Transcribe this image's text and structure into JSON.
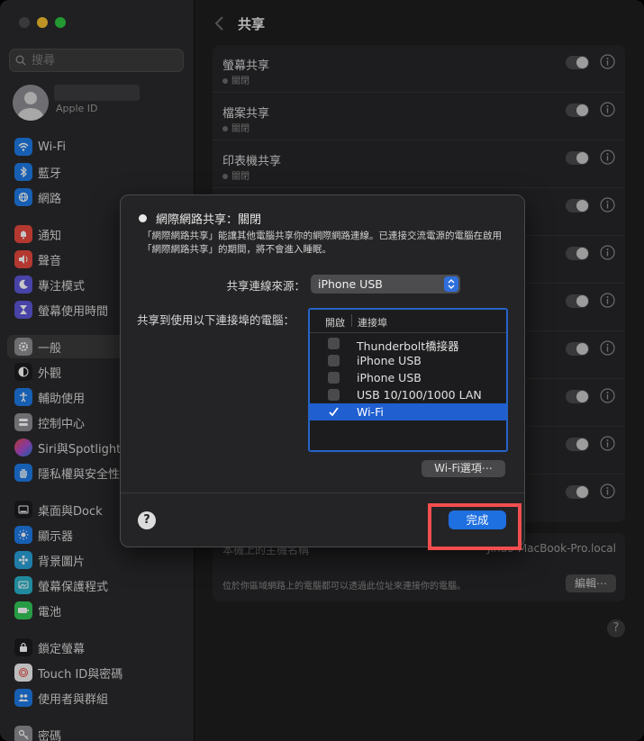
{
  "sidebar": {
    "search_placeholder": "搜尋",
    "profile_sub": "Apple ID",
    "items": [
      {
        "label": "Wi-Fi",
        "icon": "wifi-icon",
        "color": "#1e7ae6"
      },
      {
        "label": "藍牙",
        "icon": "bluetooth-icon",
        "color": "#1e7ae6"
      },
      {
        "label": "網路",
        "icon": "network-icon",
        "color": "#1e7ae6"
      },
      {
        "label": "通知",
        "icon": "bell-icon",
        "color": "#e5483e"
      },
      {
        "label": "聲音",
        "icon": "speaker-icon",
        "color": "#e5483e"
      },
      {
        "label": "專注模式",
        "icon": "moon-icon",
        "color": "#5b56d6"
      },
      {
        "label": "螢幕使用時間",
        "icon": "hourglass-icon",
        "color": "#5b56d6"
      },
      {
        "label": "一般",
        "icon": "gear-icon",
        "color": "#8e8e93"
      },
      {
        "label": "外觀",
        "icon": "appearance-icon",
        "color": "#1c1c1e"
      },
      {
        "label": "輔助使用",
        "icon": "accessibility-icon",
        "color": "#1e7ae6"
      },
      {
        "label": "控制中心",
        "icon": "control-center-icon",
        "color": "#8e8e93"
      },
      {
        "label": "Siri與Spotlight",
        "icon": "siri-icon",
        "color": "#b04ac8"
      },
      {
        "label": "隱私權與安全性",
        "icon": "hand-icon",
        "color": "#1e7ae6"
      },
      {
        "label": "桌面與Dock",
        "icon": "dock-icon",
        "color": "#1c1c1e"
      },
      {
        "label": "顯示器",
        "icon": "display-icon",
        "color": "#1e7ae6"
      },
      {
        "label": "背景圖片",
        "icon": "wallpaper-icon",
        "color": "#2aa0d8"
      },
      {
        "label": "螢幕保護程式",
        "icon": "screensaver-icon",
        "color": "#2ab0c8"
      },
      {
        "label": "電池",
        "icon": "battery-icon",
        "color": "#34c759"
      },
      {
        "label": "鎖定螢幕",
        "icon": "lock-icon",
        "color": "#1c1c1e"
      },
      {
        "label": "Touch ID與密碼",
        "icon": "fingerprint-icon",
        "color": "#e5483e"
      },
      {
        "label": "使用者與群組",
        "icon": "users-icon",
        "color": "#1e7ae6"
      },
      {
        "label": "密碼",
        "icon": "key-icon",
        "color": "#8e8e93"
      }
    ]
  },
  "main": {
    "title": "共享",
    "rows": [
      {
        "title": "螢幕共享",
        "status": "關閉"
      },
      {
        "title": "檔案共享",
        "status": "關閉"
      },
      {
        "title": "印表機共享",
        "status": "關閉"
      }
    ],
    "hostname_label": "本機上的主機名稱",
    "hostname_value": "Jindo-MacBook-Pro.local",
    "hostname_desc": "位於你區域網路上的電腦都可以透過此位址來連接你的電腦。",
    "edit_label": "編輯⋯",
    "help": "?"
  },
  "dialog": {
    "title": "網際網路共享：關閉",
    "description": "「網際網路共享」能讓其他電腦共享你的網際網路連線。已連接交流電源的電腦在啟用「網際網路共享」的期間，將不會進入睡眠。",
    "source_label": "共享連線來源：",
    "source_value": "iPhone USB",
    "to_label": "共享到使用以下連接埠的電腦：",
    "col_on": "開啟",
    "col_port": "連接埠",
    "ports": [
      {
        "label": "Thunderbolt橋接器",
        "checked": false
      },
      {
        "label": "iPhone USB",
        "checked": false
      },
      {
        "label": "iPhone USB",
        "checked": false
      },
      {
        "label": "USB 10/100/1000 LAN",
        "checked": false
      },
      {
        "label": "Wi-Fi",
        "checked": true
      }
    ],
    "wifi_options": "Wi-Fi選項⋯",
    "help": "?",
    "done": "完成"
  },
  "colors": {
    "accent": "#1e6fe0",
    "highlight": "#f24e4e"
  }
}
